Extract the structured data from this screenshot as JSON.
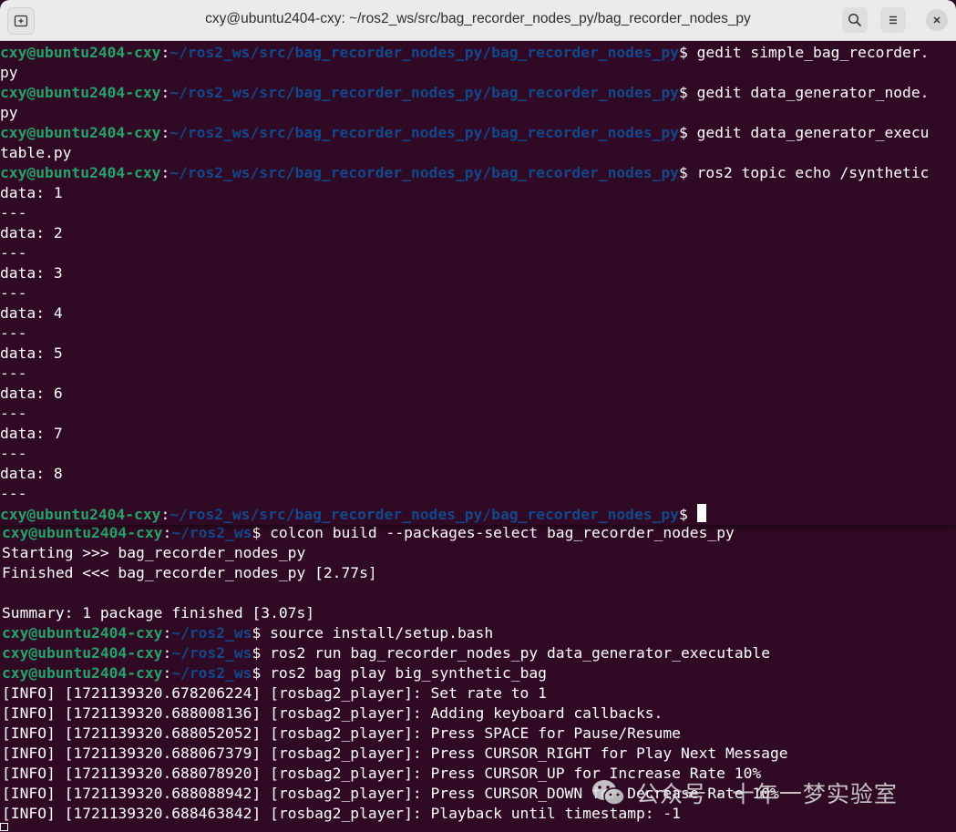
{
  "window": {
    "title": "cxy@ubuntu2404-cxy: ~/ros2_ws/src/bag_recorder_nodes_py/bag_recorder_nodes_py"
  },
  "top_terminal": {
    "lines": [
      {
        "user": "cxy@ubuntu2404-cxy",
        "sep": ":",
        "path": "~/ros2_ws/src/bag_recorder_nodes_py/bag_recorder_nodes_py",
        "cmd": "$ gedit simple_bag_recorder."
      },
      {
        "text": "py"
      },
      {
        "user": "cxy@ubuntu2404-cxy",
        "sep": ":",
        "path": "~/ros2_ws/src/bag_recorder_nodes_py/bag_recorder_nodes_py",
        "cmd": "$ gedit data_generator_node."
      },
      {
        "text": "py"
      },
      {
        "user": "cxy@ubuntu2404-cxy",
        "sep": ":",
        "path": "~/ros2_ws/src/bag_recorder_nodes_py/bag_recorder_nodes_py",
        "cmd": "$ gedit data_generator_execu"
      },
      {
        "text": "table.py"
      },
      {
        "user": "cxy@ubuntu2404-cxy",
        "sep": ":",
        "path": "~/ros2_ws/src/bag_recorder_nodes_py/bag_recorder_nodes_py",
        "cmd": "$ ros2 topic echo /synthetic"
      },
      {
        "text": "data: 1"
      },
      {
        "text": "---"
      },
      {
        "text": "data: 2"
      },
      {
        "text": "---"
      },
      {
        "text": "data: 3"
      },
      {
        "text": "---"
      },
      {
        "text": "data: 4"
      },
      {
        "text": "---"
      },
      {
        "text": "data: 5"
      },
      {
        "text": "---"
      },
      {
        "text": "data: 6"
      },
      {
        "text": "---"
      },
      {
        "text": "data: 7"
      },
      {
        "text": "---"
      },
      {
        "text": "data: 8"
      },
      {
        "text": "---"
      },
      {
        "user": "cxy@ubuntu2404-cxy",
        "sep": ":",
        "path": "~/ros2_ws/src/bag_recorder_nodes_py/bag_recorder_nodes_py",
        "cmd": "$ ",
        "cursor": true
      }
    ]
  },
  "bottom_terminal": {
    "lines": [
      {
        "user": "cxy@ubuntu2404-cxy",
        "sep": ":",
        "path": "~/ros2_ws",
        "cmd": "$ colcon build --packages-select bag_recorder_nodes_py"
      },
      {
        "text": "Starting >>> bag_recorder_nodes_py"
      },
      {
        "text": "Finished <<< bag_recorder_nodes_py [2.77s]"
      },
      {
        "text": ""
      },
      {
        "text": "Summary: 1 package finished [3.07s]"
      },
      {
        "user": "cxy@ubuntu2404-cxy",
        "sep": ":",
        "path": "~/ros2_ws",
        "cmd": "$ source install/setup.bash"
      },
      {
        "user": "cxy@ubuntu2404-cxy",
        "sep": ":",
        "path": "~/ros2_ws",
        "cmd": "$ ros2 run bag_recorder_nodes_py data_generator_executable"
      },
      {
        "user": "cxy@ubuntu2404-cxy",
        "sep": ":",
        "path": "~/ros2_ws",
        "cmd": "$ ros2 bag play big_synthetic_bag"
      },
      {
        "text": "[INFO] [1721139320.678206224] [rosbag2_player]: Set rate to 1"
      },
      {
        "text": "[INFO] [1721139320.688008136] [rosbag2_player]: Adding keyboard callbacks."
      },
      {
        "text": "[INFO] [1721139320.688052052] [rosbag2_player]: Press SPACE for Pause/Resume"
      },
      {
        "text": "[INFO] [1721139320.688067379] [rosbag2_player]: Press CURSOR_RIGHT for Play Next Message"
      },
      {
        "text": "[INFO] [1721139320.688078920] [rosbag2_player]: Press CURSOR_UP for Increase Rate 10%"
      },
      {
        "text": "[INFO] [1721139320.688088942] [rosbag2_player]: Press CURSOR_DOWN for Decrease Rate 10%"
      },
      {
        "text": "[INFO] [1721139320.688463842] [rosbag2_player]: Playback until timestamp: -1"
      }
    ]
  },
  "watermark": {
    "text": "公众号 · 十年一梦实验室"
  },
  "icons": {
    "new_tab": "new-tab-icon",
    "search": "search-icon",
    "menu": "hamburger-menu-icon",
    "close": "close-icon",
    "watermark": "wechat-icon"
  },
  "colors": {
    "background": "#300a24",
    "user": "#26a269",
    "path": "#12488b",
    "text": "#ffffff",
    "titlebar": "#ebebeb"
  }
}
